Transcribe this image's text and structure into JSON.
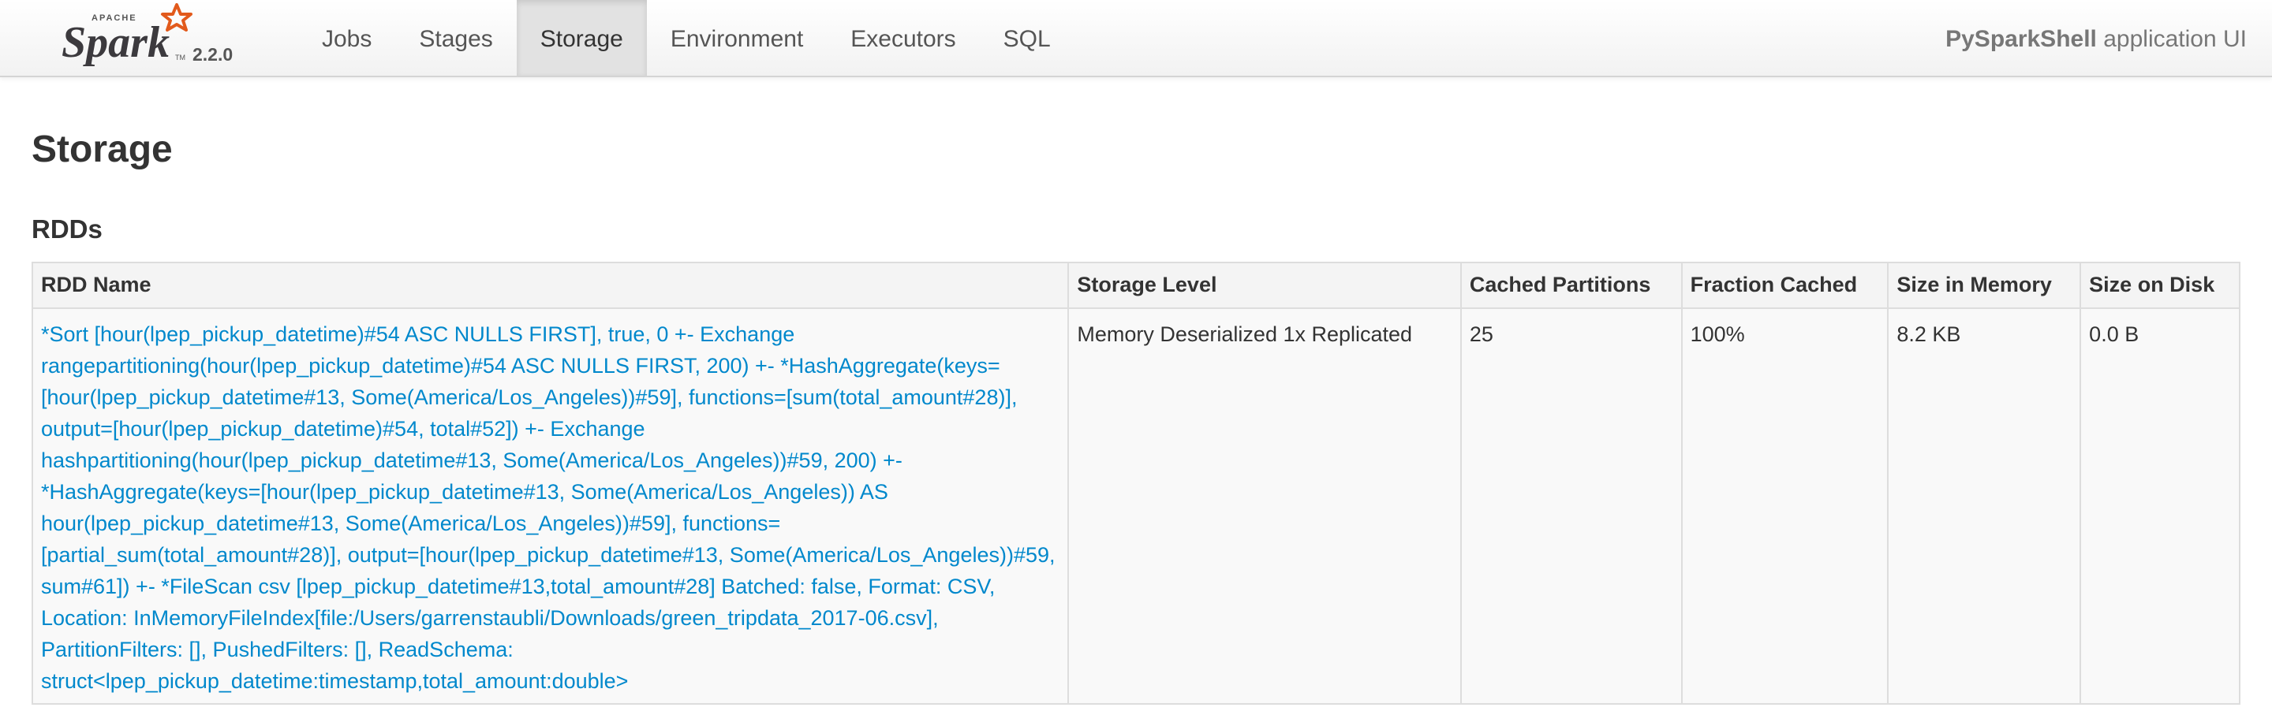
{
  "header": {
    "logo_text": "APACHE Spark",
    "version": "2.2.0",
    "tabs": [
      {
        "label": "Jobs",
        "active": false
      },
      {
        "label": "Stages",
        "active": false
      },
      {
        "label": "Storage",
        "active": true
      },
      {
        "label": "Environment",
        "active": false
      },
      {
        "label": "Executors",
        "active": false
      },
      {
        "label": "SQL",
        "active": false
      }
    ],
    "app_name": "PySparkShell",
    "app_suffix": "application UI"
  },
  "page": {
    "title": "Storage",
    "section_title": "RDDs"
  },
  "table": {
    "columns": [
      "RDD Name",
      "Storage Level",
      "Cached Partitions",
      "Fraction Cached",
      "Size in Memory",
      "Size on Disk"
    ],
    "rows": [
      {
        "name": "*Sort [hour(lpep_pickup_datetime)#54 ASC NULLS FIRST], true, 0 +- Exchange rangepartitioning(hour(lpep_pickup_datetime)#54 ASC NULLS FIRST, 200) +- *HashAggregate(keys=[hour(lpep_pickup_datetime#13, Some(America/Los_Angeles))#59], functions=[sum(total_amount#28)], output=[hour(lpep_pickup_datetime)#54, total#52]) +- Exchange hashpartitioning(hour(lpep_pickup_datetime#13, Some(America/Los_Angeles))#59, 200) +- *HashAggregate(keys=[hour(lpep_pickup_datetime#13, Some(America/Los_Angeles)) AS hour(lpep_pickup_datetime#13, Some(America/Los_Angeles))#59], functions=[partial_sum(total_amount#28)], output=[hour(lpep_pickup_datetime#13, Some(America/Los_Angeles))#59, sum#61]) +- *FileScan csv [lpep_pickup_datetime#13,total_amount#28] Batched: false, Format: CSV, Location: InMemoryFileIndex[file:/Users/garrenstaubli/Downloads/green_tripdata_2017-06.csv], PartitionFilters: [], PushedFilters: [], ReadSchema: struct<lpep_pickup_datetime:timestamp,total_amount:double>",
        "storage_level": "Memory Deserialized 1x Replicated",
        "cached_partitions": "25",
        "fraction_cached": "100%",
        "size_in_memory": "8.2 KB",
        "size_on_disk": "0.0 B"
      }
    ]
  },
  "colors": {
    "link": "#0088cc",
    "spark_orange": "#e25a1c",
    "active_tab_bg": "#e2e2e2"
  }
}
